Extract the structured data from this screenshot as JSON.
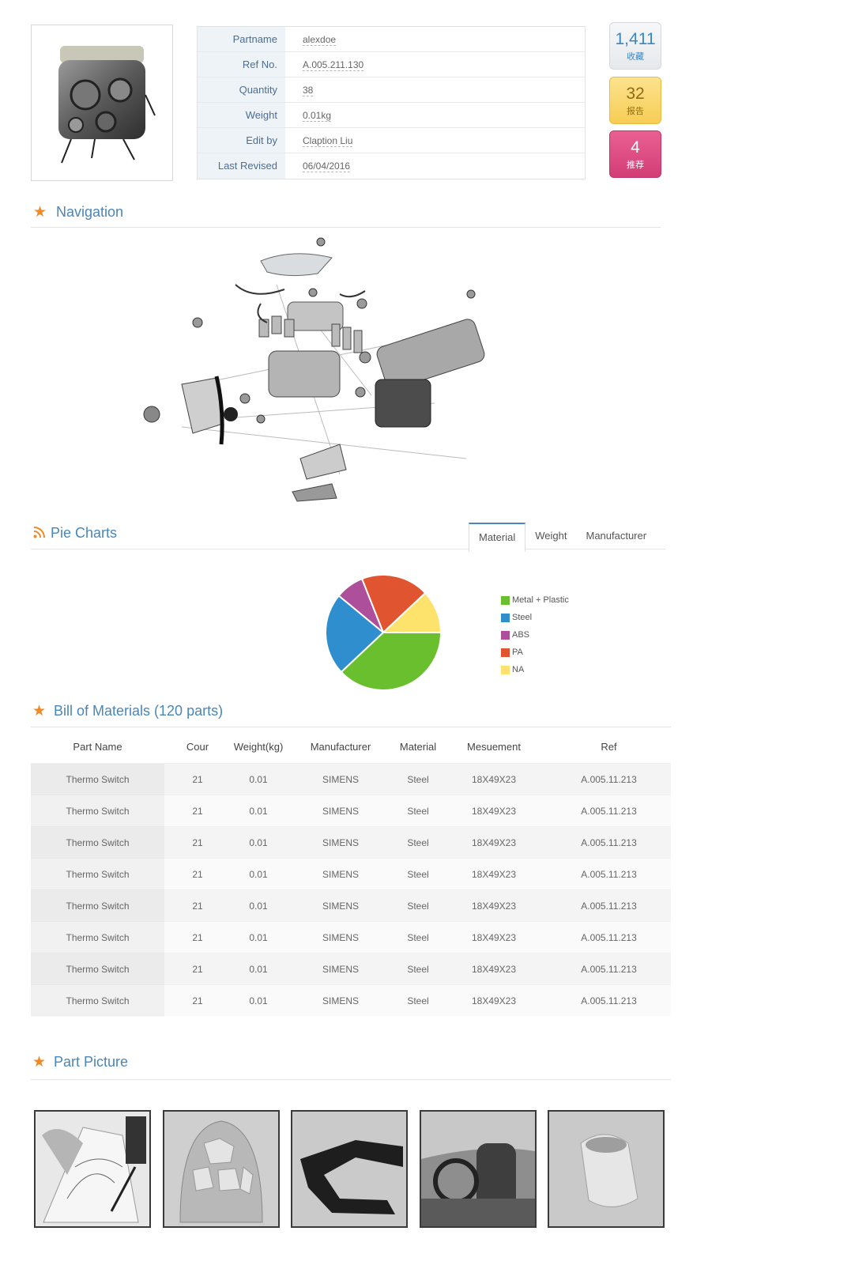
{
  "part": {
    "thumbnail_icon": "engine-photo",
    "fields": [
      {
        "key": "Partname",
        "value": "alexdoe"
      },
      {
        "key": "Ref No.",
        "value": "A.005.211.130"
      },
      {
        "key": "Quantity",
        "value": "38"
      },
      {
        "key": "Weight",
        "value": "0.01kg"
      },
      {
        "key": "Edit by",
        "value": "Claption Liu"
      },
      {
        "key": "Last Revised",
        "value": "06/04/2016"
      }
    ]
  },
  "stats": [
    {
      "value": "1,411",
      "label": "收藏"
    },
    {
      "value": "32",
      "label": "报告"
    },
    {
      "value": "4",
      "label": "推荐"
    }
  ],
  "navigation": {
    "title": "Navigation",
    "icon": "star-icon",
    "image": "exploded-engine-diagram"
  },
  "pie_section": {
    "title": "Pie Charts",
    "icon": "rss-icon",
    "tabs": [
      "Material",
      "Weight",
      "Manufacturer"
    ],
    "active_tab": "Material"
  },
  "chart_data": {
    "type": "pie",
    "categories": [
      "Metal + Plastic",
      "Steel",
      "ABS",
      "PA",
      "NA"
    ],
    "values": [
      38,
      23,
      8,
      19,
      12
    ],
    "colors": [
      "#6abf2e",
      "#2f8fce",
      "#ae4f9b",
      "#e0552f",
      "#fde26c"
    ],
    "legend_position": "right"
  },
  "bom": {
    "title": "Bill of Materials (120 parts)",
    "icon": "star-icon",
    "columns": [
      "Part Name",
      "Cour",
      "Weight(kg)",
      "Manufacturer",
      "Material",
      "Mesuement",
      "Ref"
    ],
    "rows": [
      [
        "Thermo Switch",
        "21",
        "0.01",
        "SIMENS",
        "Steel",
        "18X49X23",
        "A.005.11.213"
      ],
      [
        "Thermo Switch",
        "21",
        "0.01",
        "SIMENS",
        "Steel",
        "18X49X23",
        "A.005.11.213"
      ],
      [
        "Thermo Switch",
        "21",
        "0.01",
        "SIMENS",
        "Steel",
        "18X49X23",
        "A.005.11.213"
      ],
      [
        "Thermo Switch",
        "21",
        "0.01",
        "SIMENS",
        "Steel",
        "18X49X23",
        "A.005.11.213"
      ],
      [
        "Thermo Switch",
        "21",
        "0.01",
        "SIMENS",
        "Steel",
        "18X49X23",
        "A.005.11.213"
      ],
      [
        "Thermo Switch",
        "21",
        "0.01",
        "SIMENS",
        "Steel",
        "18X49X23",
        "A.005.11.213"
      ],
      [
        "Thermo Switch",
        "21",
        "0.01",
        "SIMENS",
        "Steel",
        "18X49X23",
        "A.005.11.213"
      ],
      [
        "Thermo Switch",
        "21",
        "0.01",
        "SIMENS",
        "Steel",
        "18X49X23",
        "A.005.11.213"
      ]
    ]
  },
  "part_picture": {
    "title": "Part Picture",
    "icon": "star-icon",
    "images": [
      "sketch-photo",
      "hood-panel-photo",
      "frame-bracket-photo",
      "car-interior-photo",
      "molded-part-photo"
    ]
  }
}
